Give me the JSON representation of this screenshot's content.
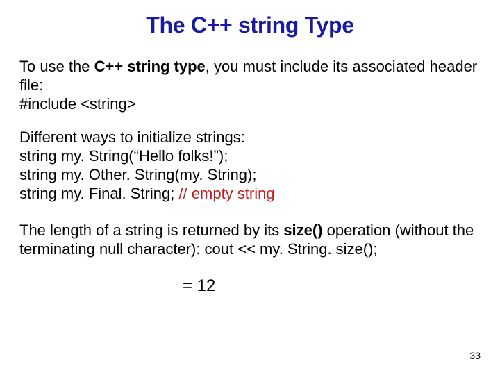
{
  "title": {
    "w1": "The",
    "w2": "C++",
    "w3": "string",
    "w4": "Type"
  },
  "p1": {
    "prefix": "To use the ",
    "bold": "C++ string type",
    "suffix": ", you must include its associated header file:",
    "include": "#include <string>"
  },
  "p2": {
    "lead": "Different ways to initialize strings:",
    "line1": "string my. String(“Hello folks!”);",
    "line2": "string my. Other. String(my. String);",
    "line3a": "string my. Final. String;       ",
    "line3b": "// empty string"
  },
  "p3": {
    "prefix": "The length of a string is returned by its ",
    "bold": "size()",
    "suffix": " operation (without the terminating null character):  cout << my. String. size();"
  },
  "result": "= 12",
  "page": "33"
}
